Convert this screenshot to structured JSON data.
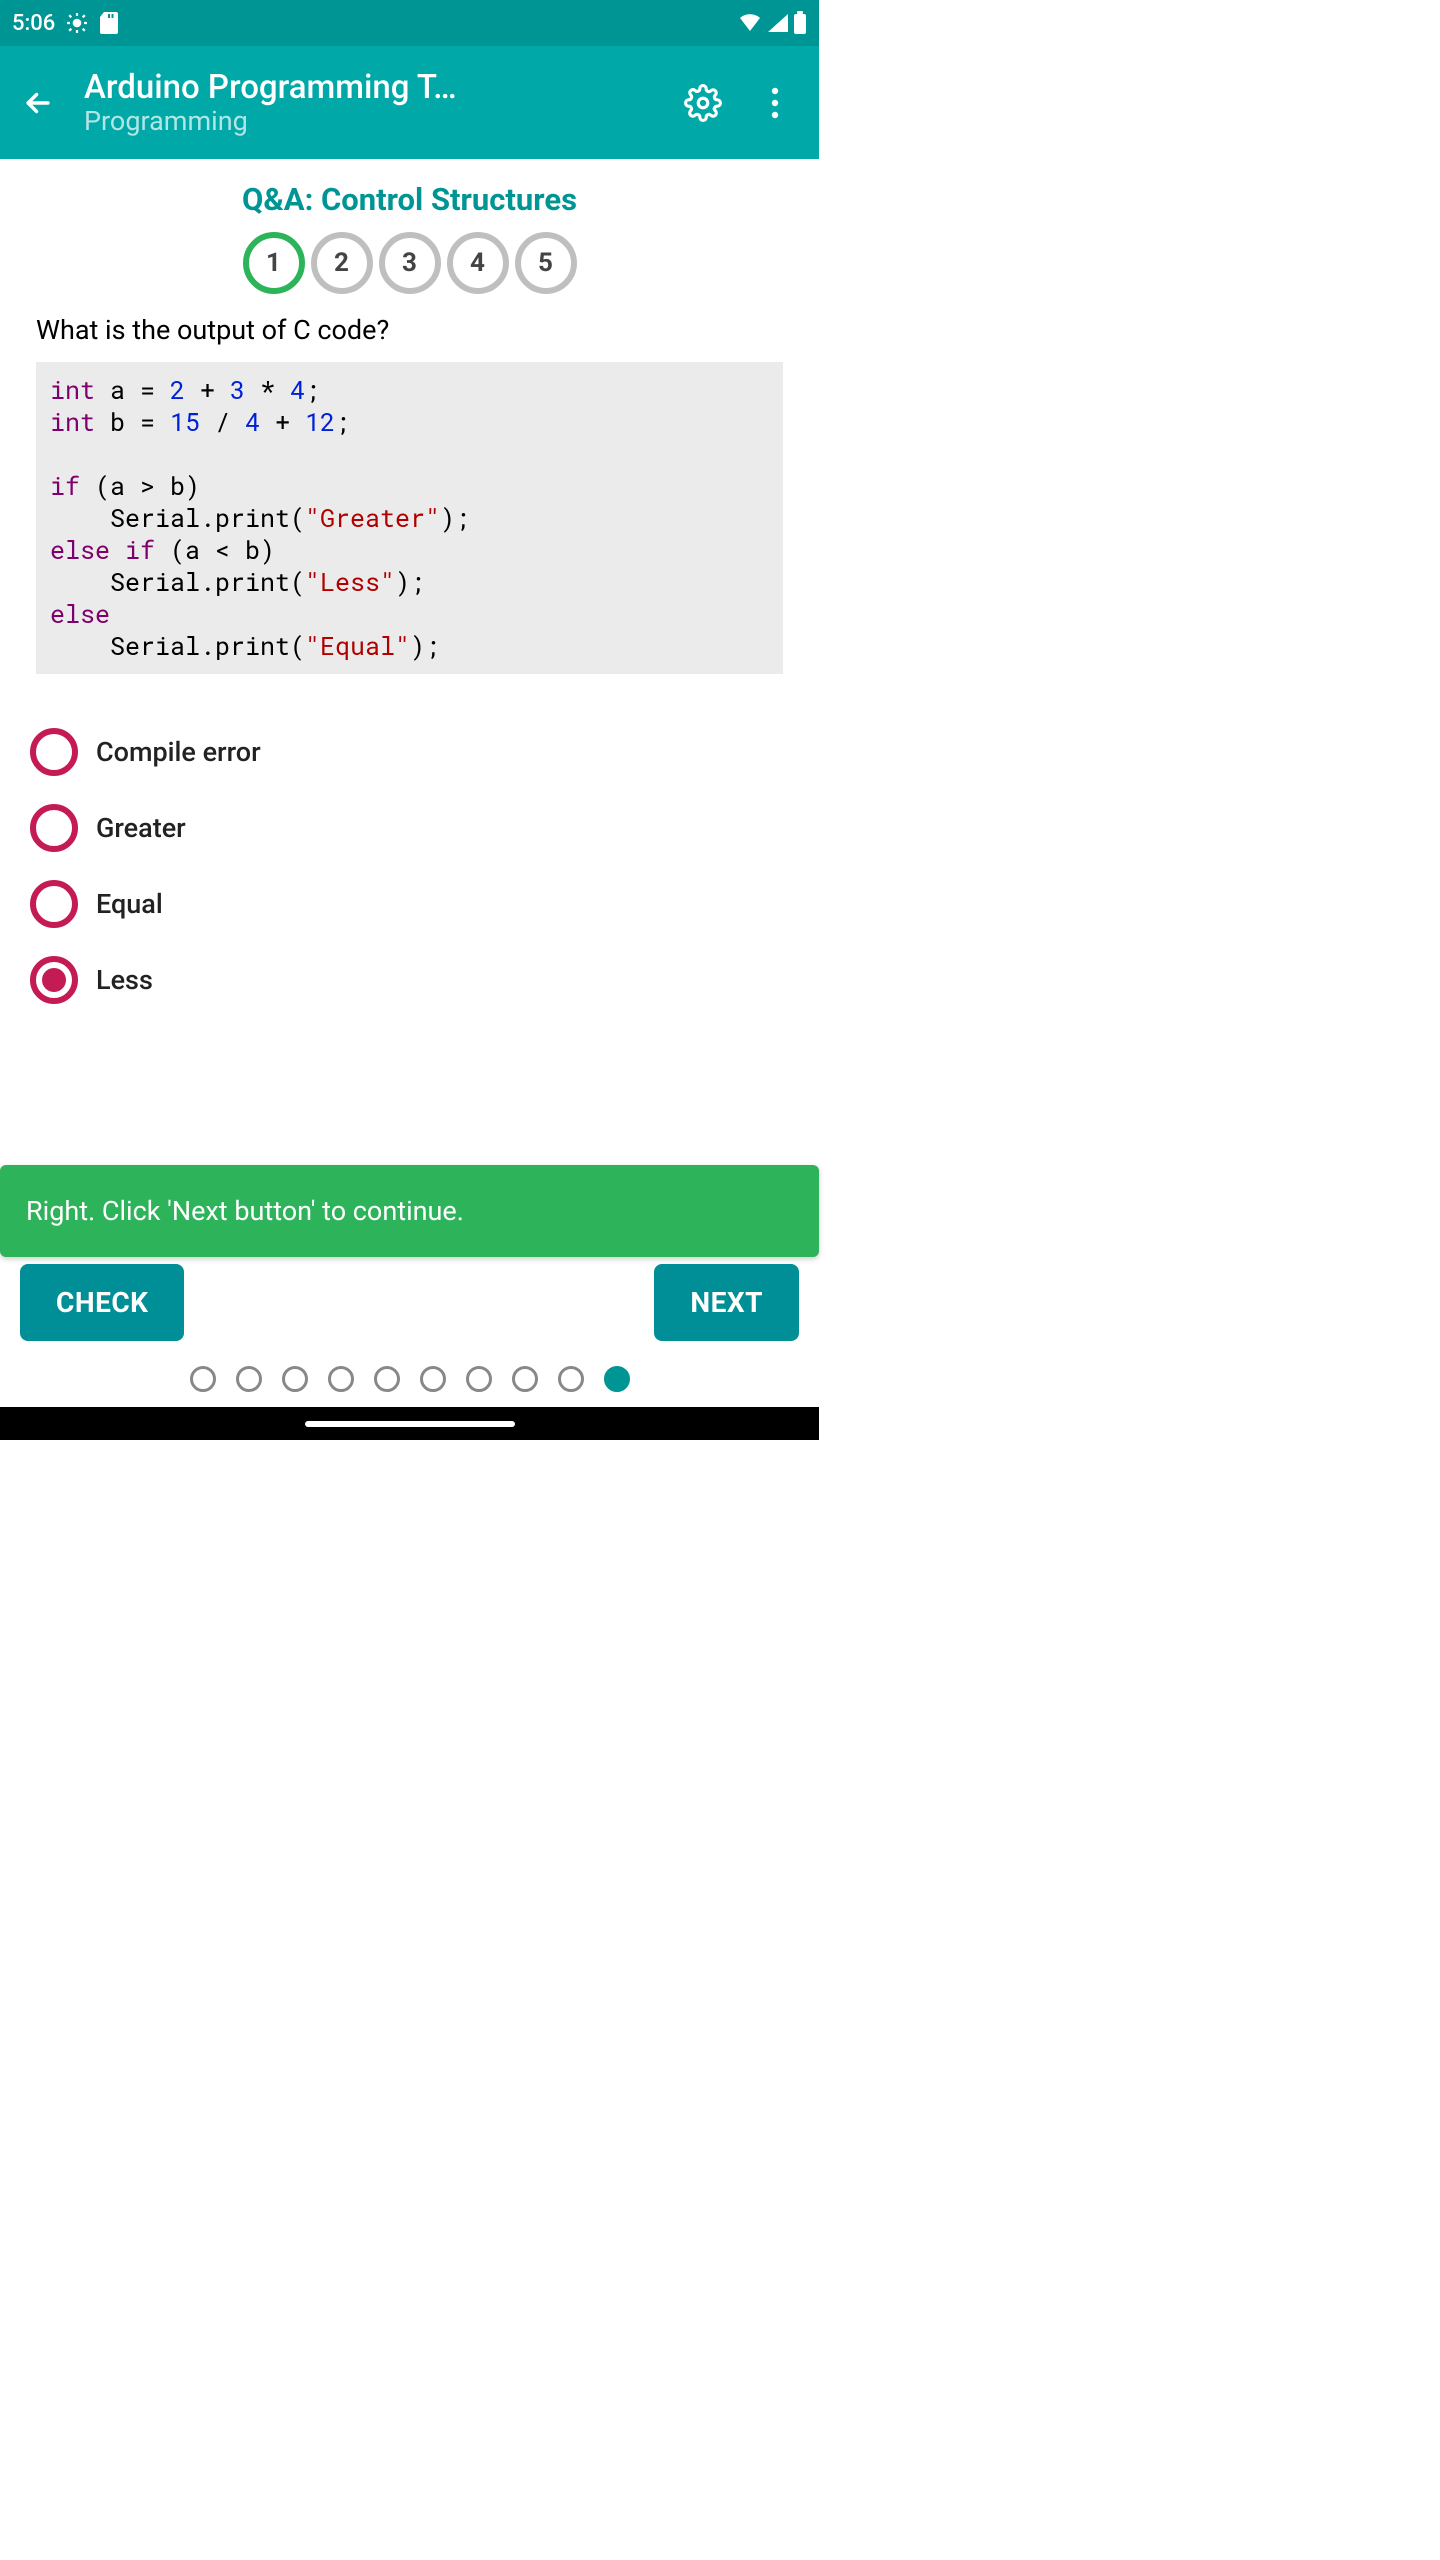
{
  "status": {
    "time": "5:06"
  },
  "appbar": {
    "title": "Arduino Programming T…",
    "subtitle": "Programming"
  },
  "qa": {
    "heading": "Q&A: Control Structures",
    "steps": [
      "1",
      "2",
      "3",
      "4",
      "5"
    ],
    "active_step": 0,
    "question": "What is the output of C code?"
  },
  "code": {
    "line1": {
      "kw1": "int",
      "txt1": " a = ",
      "n1": "2",
      "txt2": " + ",
      "n2": "3",
      "txt3": " * ",
      "n3": "4",
      "txt4": ";"
    },
    "line2": {
      "kw1": "int",
      "txt1": " b = ",
      "n1": "15",
      "txt2": " / ",
      "n2": "4",
      "txt3": " + ",
      "n3": "12",
      "txt4": ";"
    },
    "line3": {
      "kw1": "if",
      "txt1": " (a > b)"
    },
    "line4": {
      "txt1": "    Serial.print(",
      "s1": "\"Greater\"",
      "txt2": ");"
    },
    "line5": {
      "kw1": "else if",
      "txt1": " (a < b)"
    },
    "line6": {
      "txt1": "    Serial.print(",
      "s1": "\"Less\"",
      "txt2": ");"
    },
    "line7": {
      "kw1": "else"
    },
    "line8": {
      "txt1": "    Serial.print(",
      "s1": "\"Equal\"",
      "txt2": ");"
    }
  },
  "answers": [
    {
      "label": "Compile error",
      "selected": false
    },
    {
      "label": "Greater",
      "selected": false
    },
    {
      "label": "Equal",
      "selected": false
    },
    {
      "label": "Less",
      "selected": true
    }
  ],
  "feedback": "Right. Click 'Next button' to continue.",
  "buttons": {
    "check": "CHECK",
    "next": "NEXT"
  },
  "pager": {
    "count": 10,
    "active": 9
  },
  "colors": {
    "brand": "#009595",
    "accent": "#c41b54",
    "success": "#2db35a"
  }
}
